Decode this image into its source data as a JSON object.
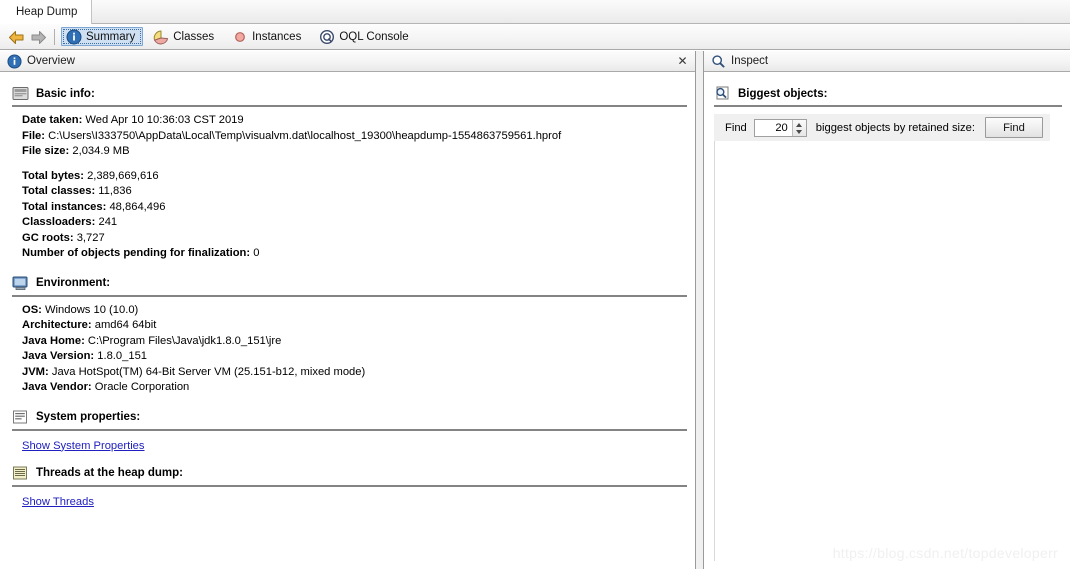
{
  "window": {
    "tab_title": "Heap Dump"
  },
  "toolbar": {
    "back_icon": "arrow-left-icon",
    "forward_icon": "arrow-right-icon",
    "tabs": [
      {
        "label": "Summary",
        "icon": "info-icon",
        "active": true
      },
      {
        "label": "Classes",
        "icon": "pie-chart-icon",
        "active": false
      },
      {
        "label": "Instances",
        "icon": "circle-icon",
        "active": false
      },
      {
        "label": "OQL Console",
        "icon": "oql-icon",
        "active": false
      }
    ]
  },
  "left_pane": {
    "header": {
      "title": "Overview",
      "icon": "info-icon",
      "close_label": "✕"
    },
    "sections": [
      {
        "title": "Basic info:",
        "icon": "card-icon",
        "rows": [
          {
            "key": "Date taken:",
            "value": "Wed Apr 10 10:36:03 CST 2019"
          },
          {
            "key": "File:",
            "value": "C:\\Users\\I333750\\AppData\\Local\\Temp\\visualvm.dat\\localhost_19300\\heapdump-1554863759561.hprof"
          },
          {
            "key": "File size:",
            "value": "2,034.9 MB"
          },
          {
            "key": "",
            "value": ""
          },
          {
            "key": "Total bytes:",
            "value": "2,389,669,616"
          },
          {
            "key": "Total classes:",
            "value": "11,836"
          },
          {
            "key": "Total instances:",
            "value": "48,864,496"
          },
          {
            "key": "Classloaders:",
            "value": "241"
          },
          {
            "key": "GC roots:",
            "value": "3,727"
          },
          {
            "key": "Number of objects pending for finalization:",
            "value": "0"
          }
        ]
      },
      {
        "title": "Environment:",
        "icon": "monitor-icon",
        "rows": [
          {
            "key": "OS:",
            "value": "Windows 10 (10.0)"
          },
          {
            "key": "Architecture:",
            "value": "amd64 64bit"
          },
          {
            "key": "Java Home:",
            "value": "C:\\Program Files\\Java\\jdk1.8.0_151\\jre"
          },
          {
            "key": "Java Version:",
            "value": "1.8.0_151"
          },
          {
            "key": "JVM:",
            "value": "Java HotSpot(TM) 64-Bit Server VM (25.151-b12, mixed mode)"
          },
          {
            "key": "Java Vendor:",
            "value": "Oracle Corporation"
          }
        ]
      },
      {
        "title": "System properties:",
        "icon": "list-icon",
        "link": "Show System Properties"
      },
      {
        "title": "Threads at the heap dump:",
        "icon": "threads-icon",
        "link": "Show Threads"
      }
    ]
  },
  "right_pane": {
    "header": {
      "title": "Inspect",
      "icon": "magnifier-icon"
    },
    "section": {
      "title": "Biggest objects:",
      "icon": "magnifier-doc-icon"
    },
    "find": {
      "prefix_label": "Find",
      "count_value": "20",
      "suffix_label": "biggest objects by retained size:",
      "button_label": "Find"
    }
  },
  "watermark": "https://blog.csdn.net/topdeveloperr",
  "colors": {
    "accent_tab": "#cfe0f3",
    "link": "#2020c0",
    "rule": "#848484",
    "back_arrow": "#e8a723",
    "forward_arrow": "#9a9a9a"
  }
}
